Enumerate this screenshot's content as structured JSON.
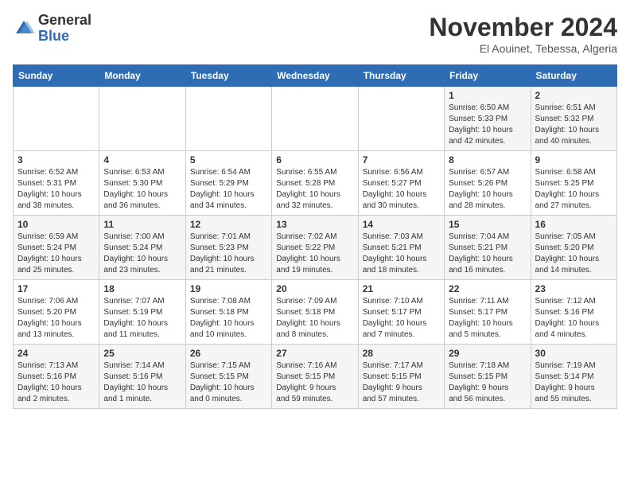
{
  "logo": {
    "general": "General",
    "blue": "Blue"
  },
  "title": "November 2024",
  "subtitle": "El Aouinet, Tebessa, Algeria",
  "headers": [
    "Sunday",
    "Monday",
    "Tuesday",
    "Wednesday",
    "Thursday",
    "Friday",
    "Saturday"
  ],
  "weeks": [
    [
      {
        "day": "",
        "info": ""
      },
      {
        "day": "",
        "info": ""
      },
      {
        "day": "",
        "info": ""
      },
      {
        "day": "",
        "info": ""
      },
      {
        "day": "",
        "info": ""
      },
      {
        "day": "1",
        "info": "Sunrise: 6:50 AM\nSunset: 5:33 PM\nDaylight: 10 hours\nand 42 minutes."
      },
      {
        "day": "2",
        "info": "Sunrise: 6:51 AM\nSunset: 5:32 PM\nDaylight: 10 hours\nand 40 minutes."
      }
    ],
    [
      {
        "day": "3",
        "info": "Sunrise: 6:52 AM\nSunset: 5:31 PM\nDaylight: 10 hours\nand 38 minutes."
      },
      {
        "day": "4",
        "info": "Sunrise: 6:53 AM\nSunset: 5:30 PM\nDaylight: 10 hours\nand 36 minutes."
      },
      {
        "day": "5",
        "info": "Sunrise: 6:54 AM\nSunset: 5:29 PM\nDaylight: 10 hours\nand 34 minutes."
      },
      {
        "day": "6",
        "info": "Sunrise: 6:55 AM\nSunset: 5:28 PM\nDaylight: 10 hours\nand 32 minutes."
      },
      {
        "day": "7",
        "info": "Sunrise: 6:56 AM\nSunset: 5:27 PM\nDaylight: 10 hours\nand 30 minutes."
      },
      {
        "day": "8",
        "info": "Sunrise: 6:57 AM\nSunset: 5:26 PM\nDaylight: 10 hours\nand 28 minutes."
      },
      {
        "day": "9",
        "info": "Sunrise: 6:58 AM\nSunset: 5:25 PM\nDaylight: 10 hours\nand 27 minutes."
      }
    ],
    [
      {
        "day": "10",
        "info": "Sunrise: 6:59 AM\nSunset: 5:24 PM\nDaylight: 10 hours\nand 25 minutes."
      },
      {
        "day": "11",
        "info": "Sunrise: 7:00 AM\nSunset: 5:24 PM\nDaylight: 10 hours\nand 23 minutes."
      },
      {
        "day": "12",
        "info": "Sunrise: 7:01 AM\nSunset: 5:23 PM\nDaylight: 10 hours\nand 21 minutes."
      },
      {
        "day": "13",
        "info": "Sunrise: 7:02 AM\nSunset: 5:22 PM\nDaylight: 10 hours\nand 19 minutes."
      },
      {
        "day": "14",
        "info": "Sunrise: 7:03 AM\nSunset: 5:21 PM\nDaylight: 10 hours\nand 18 minutes."
      },
      {
        "day": "15",
        "info": "Sunrise: 7:04 AM\nSunset: 5:21 PM\nDaylight: 10 hours\nand 16 minutes."
      },
      {
        "day": "16",
        "info": "Sunrise: 7:05 AM\nSunset: 5:20 PM\nDaylight: 10 hours\nand 14 minutes."
      }
    ],
    [
      {
        "day": "17",
        "info": "Sunrise: 7:06 AM\nSunset: 5:20 PM\nDaylight: 10 hours\nand 13 minutes."
      },
      {
        "day": "18",
        "info": "Sunrise: 7:07 AM\nSunset: 5:19 PM\nDaylight: 10 hours\nand 11 minutes."
      },
      {
        "day": "19",
        "info": "Sunrise: 7:08 AM\nSunset: 5:18 PM\nDaylight: 10 hours\nand 10 minutes."
      },
      {
        "day": "20",
        "info": "Sunrise: 7:09 AM\nSunset: 5:18 PM\nDaylight: 10 hours\nand 8 minutes."
      },
      {
        "day": "21",
        "info": "Sunrise: 7:10 AM\nSunset: 5:17 PM\nDaylight: 10 hours\nand 7 minutes."
      },
      {
        "day": "22",
        "info": "Sunrise: 7:11 AM\nSunset: 5:17 PM\nDaylight: 10 hours\nand 5 minutes."
      },
      {
        "day": "23",
        "info": "Sunrise: 7:12 AM\nSunset: 5:16 PM\nDaylight: 10 hours\nand 4 minutes."
      }
    ],
    [
      {
        "day": "24",
        "info": "Sunrise: 7:13 AM\nSunset: 5:16 PM\nDaylight: 10 hours\nand 2 minutes."
      },
      {
        "day": "25",
        "info": "Sunrise: 7:14 AM\nSunset: 5:16 PM\nDaylight: 10 hours\nand 1 minute."
      },
      {
        "day": "26",
        "info": "Sunrise: 7:15 AM\nSunset: 5:15 PM\nDaylight: 10 hours\nand 0 minutes."
      },
      {
        "day": "27",
        "info": "Sunrise: 7:16 AM\nSunset: 5:15 PM\nDaylight: 9 hours\nand 59 minutes."
      },
      {
        "day": "28",
        "info": "Sunrise: 7:17 AM\nSunset: 5:15 PM\nDaylight: 9 hours\nand 57 minutes."
      },
      {
        "day": "29",
        "info": "Sunrise: 7:18 AM\nSunset: 5:15 PM\nDaylight: 9 hours\nand 56 minutes."
      },
      {
        "day": "30",
        "info": "Sunrise: 7:19 AM\nSunset: 5:14 PM\nDaylight: 9 hours\nand 55 minutes."
      }
    ]
  ]
}
